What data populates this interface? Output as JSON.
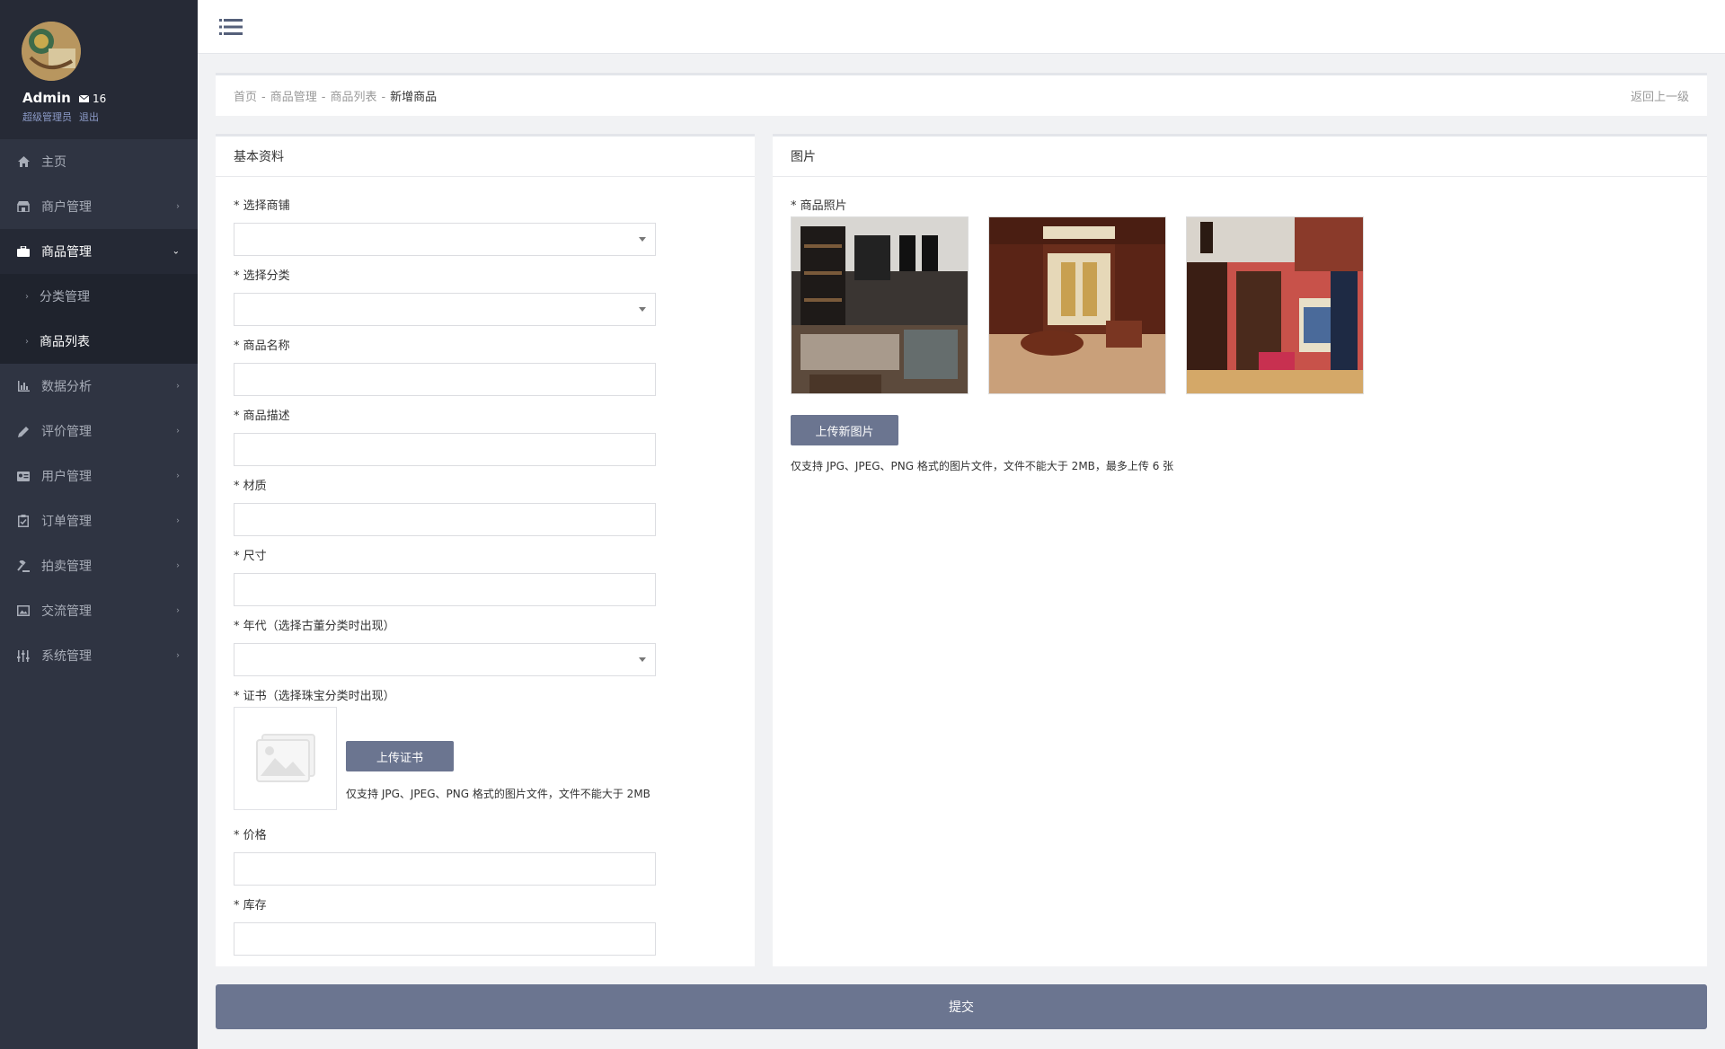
{
  "profile": {
    "name": "Admin",
    "messages": "16",
    "role": "超级管理员",
    "logout": "退出"
  },
  "menu": [
    {
      "label": "主页",
      "icon": "home-icon"
    },
    {
      "label": "商户管理",
      "icon": "store-icon"
    },
    {
      "label": "商品管理",
      "icon": "briefcase-icon"
    },
    {
      "label": "数据分析",
      "icon": "bar-chart-icon"
    },
    {
      "label": "评价管理",
      "icon": "pencil-icon"
    },
    {
      "label": "用户管理",
      "icon": "id-card-icon"
    },
    {
      "label": "订单管理",
      "icon": "clipboard-icon"
    },
    {
      "label": "拍卖管理",
      "icon": "gavel-icon"
    },
    {
      "label": "交流管理",
      "icon": "picture-icon"
    },
    {
      "label": "系统管理",
      "icon": "sliders-icon"
    }
  ],
  "submenu": [
    {
      "label": "分类管理"
    },
    {
      "label": "商品列表"
    }
  ],
  "breadcrumb": {
    "home": "首页",
    "section": "商品管理",
    "list": "商品列表",
    "current": "新增商品",
    "sep": "-",
    "back": "返回上一级"
  },
  "basic": {
    "title": "基本资料",
    "fields": {
      "shop": "* 选择商铺",
      "category": "* 选择分类",
      "name": "* 商品名称",
      "desc": "* 商品描述",
      "material": "* 材质",
      "size": "* 尺寸",
      "era": "* 年代（选择古董分类时出现）",
      "cert": "* 证书（选择珠宝分类时出现）",
      "price": "* 价格",
      "stock": "* 库存"
    },
    "cert_button": "上传证书",
    "cert_hint": "仅支持 JPG、JPEG、PNG 格式的图片文件，文件不能大于 2MB"
  },
  "images": {
    "title": "图片",
    "photos_label": "* 商品照片",
    "upload_button": "上传新图片",
    "hint": "仅支持 JPG、JPEG、PNG 格式的图片文件，文件不能大于 2MB，最多上传 6 张"
  },
  "submit": "提交"
}
